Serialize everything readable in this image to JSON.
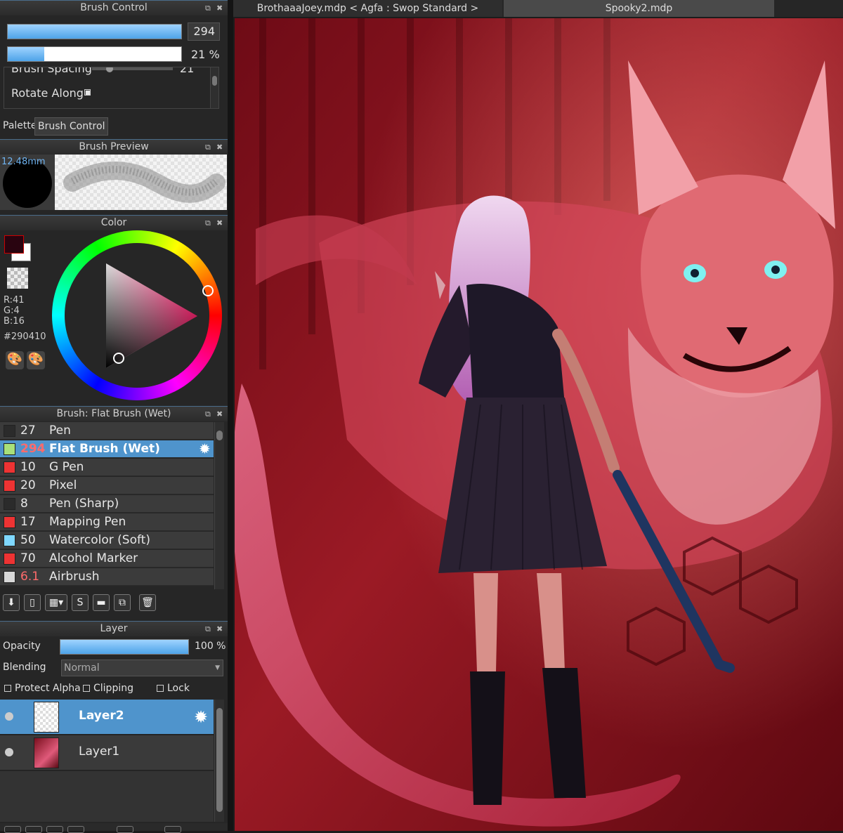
{
  "brush_control": {
    "title": "Brush Control",
    "size_value": "294",
    "opacity_value": "21 %",
    "opacity_fraction": 0.21,
    "spacing_label": "Brush Spacing",
    "spacing_value": "21",
    "rotate_label": "Rotate Along",
    "tabs": [
      "Palette",
      "Brush Control"
    ]
  },
  "brush_preview": {
    "title": "Brush Preview",
    "size": "12.48mm"
  },
  "color": {
    "title": "Color",
    "r": "R:41",
    "g": "G:4",
    "b": "B:16",
    "hex": "#290410",
    "swatch": "#290410"
  },
  "brush_list": {
    "title": "Brush: Flat Brush (Wet)",
    "items": [
      {
        "size": "27",
        "name": "Pen",
        "color": "#2b2b2b"
      },
      {
        "size": "294",
        "name": "Flat Brush (Wet)",
        "color": "#a8e07a"
      },
      {
        "size": "10",
        "name": "G Pen",
        "color": "#ee3333"
      },
      {
        "size": "20",
        "name": "Pixel",
        "color": "#ee3333"
      },
      {
        "size": "8",
        "name": "Pen (Sharp)",
        "color": "#2b2b2b"
      },
      {
        "size": "17",
        "name": "Mapping Pen",
        "color": "#ee3333"
      },
      {
        "size": "50",
        "name": "Watercolor (Soft)",
        "color": "#7fd8ff"
      },
      {
        "size": "70",
        "name": "Alcohol Marker",
        "color": "#ee3333"
      },
      {
        "size": "6.1",
        "name": "Airbrush",
        "color": "#d8d8d8"
      }
    ]
  },
  "layer": {
    "title": "Layer",
    "opacity_label": "Opacity",
    "opacity_value": "100 %",
    "blending_label": "Blending",
    "blending_value": "Normal",
    "protect_alpha": "Protect Alpha",
    "clipping": "Clipping",
    "lock": "Lock",
    "layers": [
      {
        "name": "Layer2"
      },
      {
        "name": "Layer1"
      }
    ]
  },
  "documents": {
    "tabs": [
      "BrothaaaJoey.mdp < Agfa : Swop Standard >",
      "Spooky2.mdp"
    ]
  }
}
